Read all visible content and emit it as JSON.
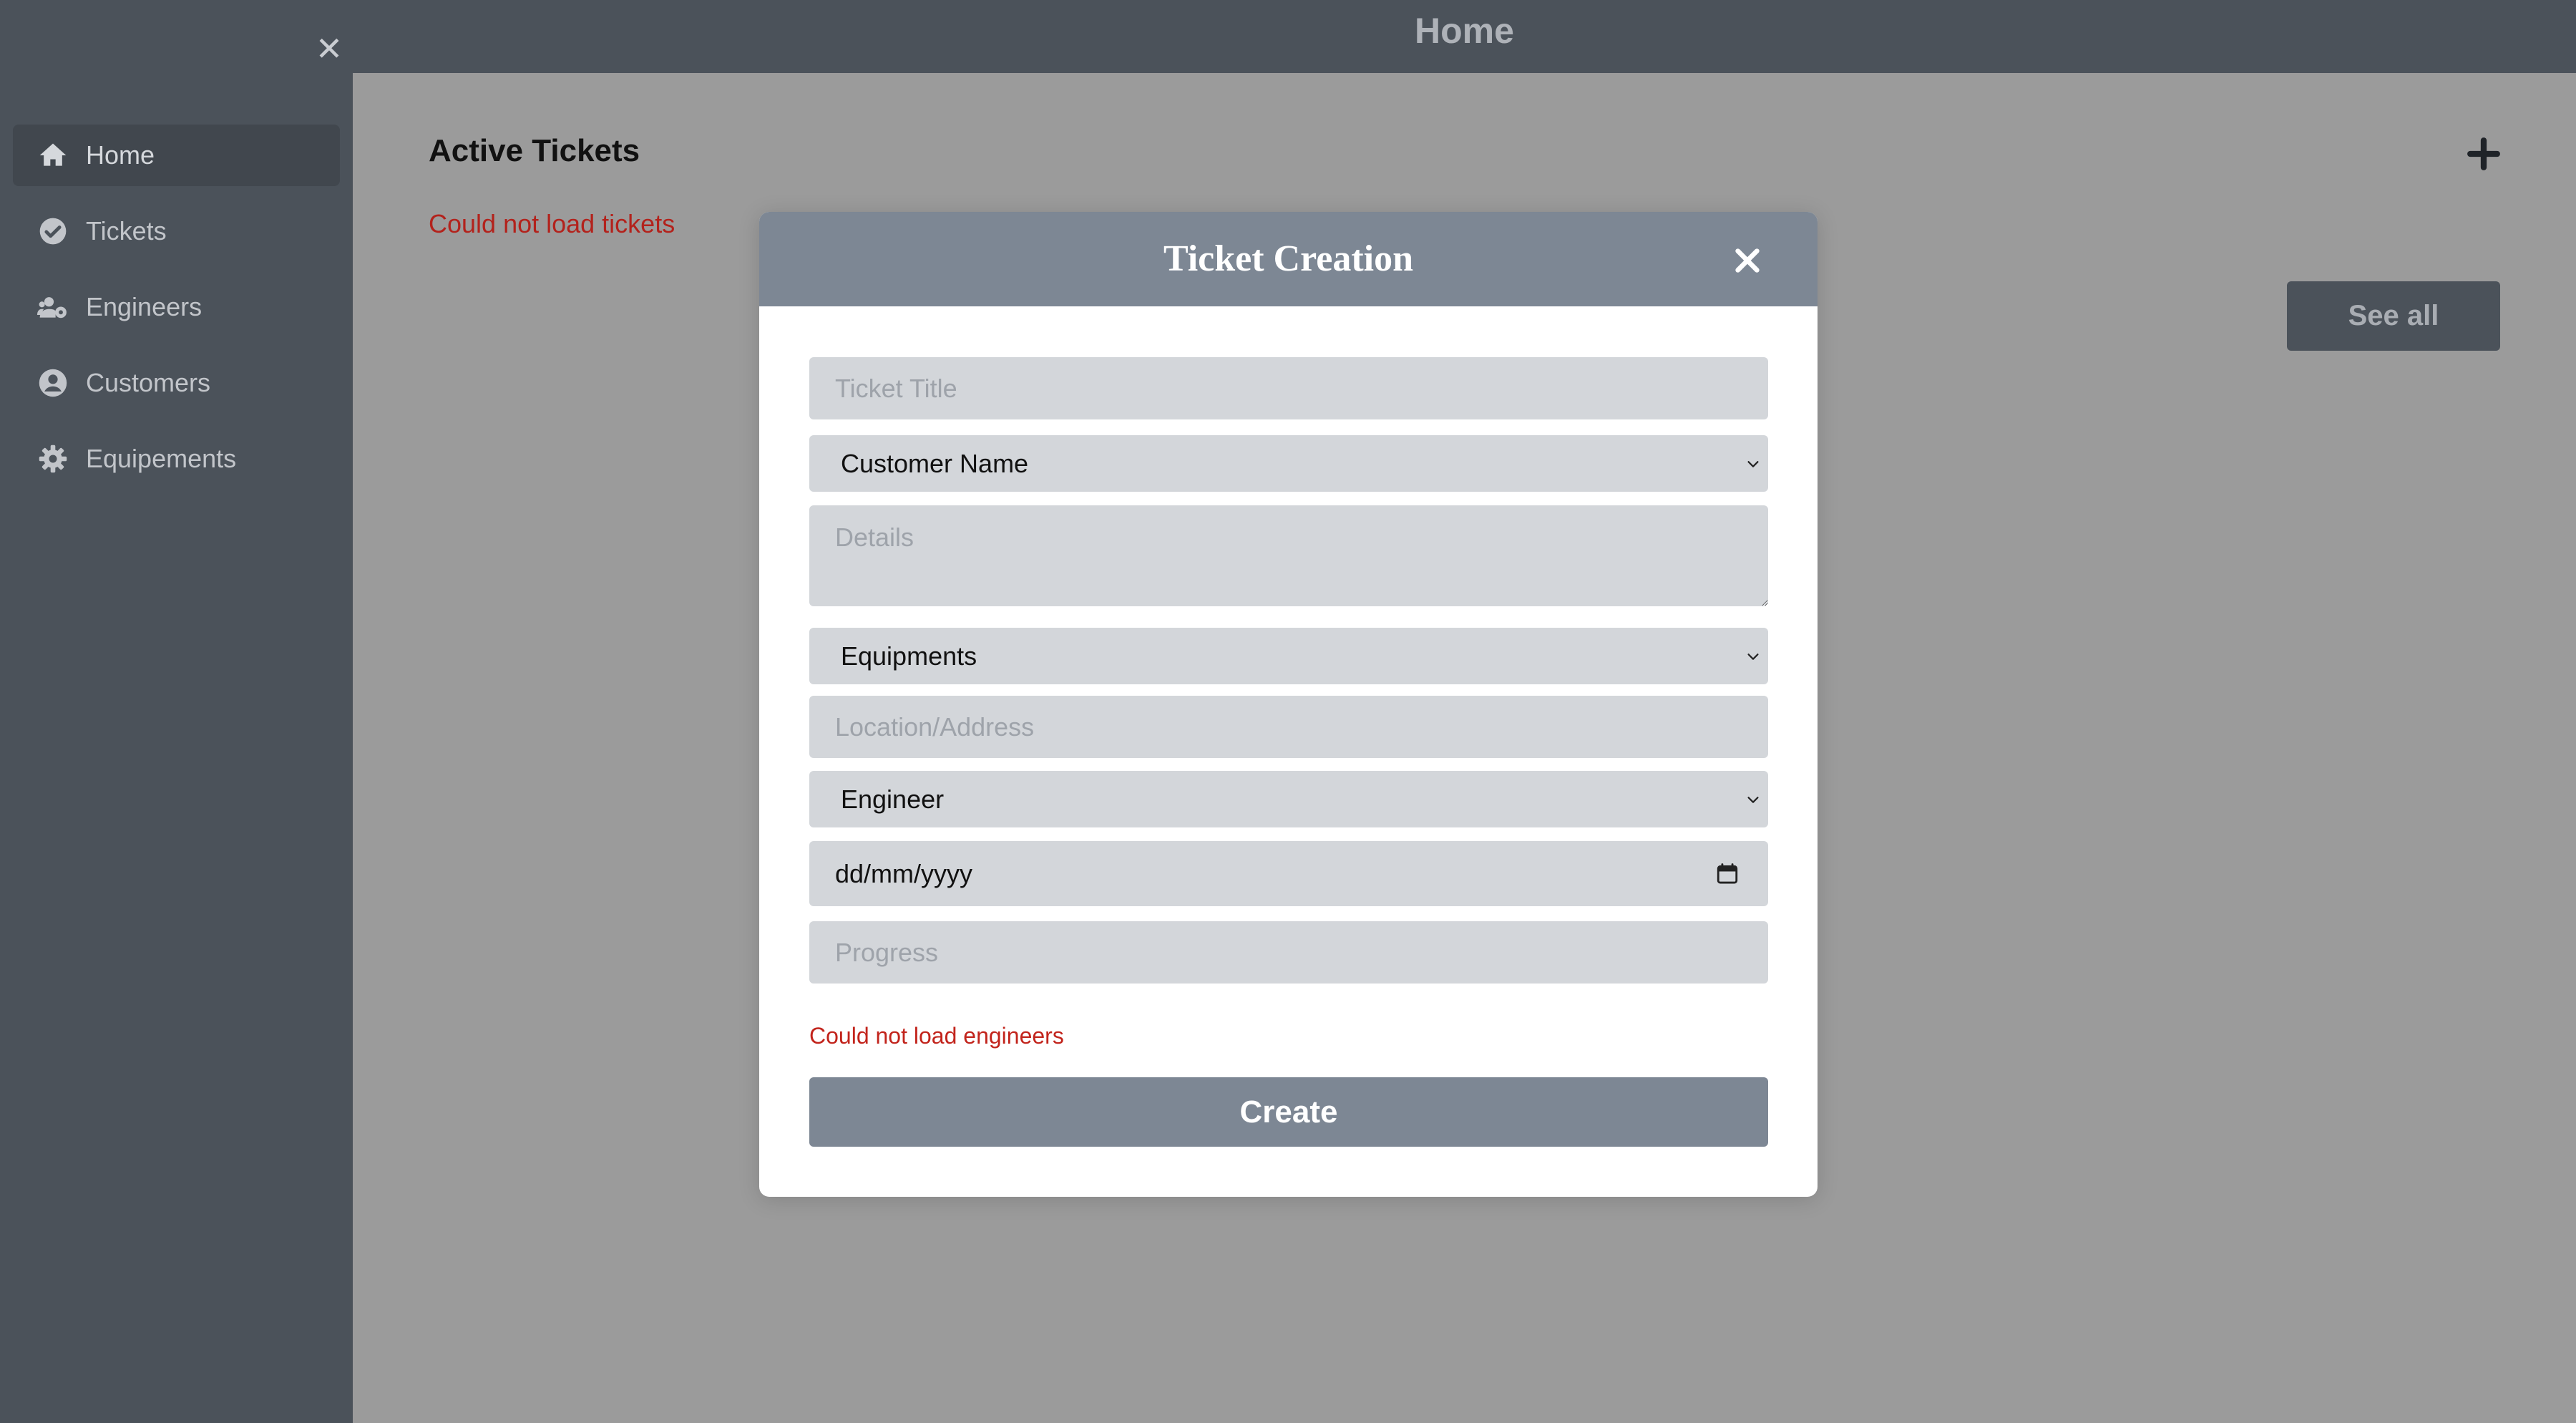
{
  "header": {
    "title": "Home"
  },
  "sidebar": {
    "close_icon": "close-icon",
    "items": [
      {
        "label": "Home",
        "icon": "home-icon",
        "active": true
      },
      {
        "label": "Tickets",
        "icon": "check-circle-icon",
        "active": false
      },
      {
        "label": "Engineers",
        "icon": "users-cog-icon",
        "active": false
      },
      {
        "label": "Customers",
        "icon": "user-circle-icon",
        "active": false
      },
      {
        "label": "Equipements",
        "icon": "gear-icon",
        "active": false
      }
    ]
  },
  "main": {
    "title": "Active Tickets",
    "error": "Could not load tickets",
    "add_icon": "plus-icon",
    "see_all_label": "See all"
  },
  "modal": {
    "title": "Ticket Creation",
    "close_icon": "close-icon",
    "fields": {
      "title_placeholder": "Ticket Title",
      "customer_selected": "Customer Name",
      "details_placeholder": "Details",
      "equipments_selected": "Equipments",
      "location_placeholder": "Location/Address",
      "engineer_selected": "Engineer",
      "date_value": "dd/mm/yyyy",
      "progress_placeholder": "Progress"
    },
    "error": "Could not load engineers",
    "create_label": "Create"
  },
  "colors": {
    "sidebar_bg": "#4b525a",
    "modal_header": "#7d8794",
    "overlay_bg": "#9b9b9b",
    "field_bg": "#d3d6da",
    "error_text": "#c2241c"
  }
}
